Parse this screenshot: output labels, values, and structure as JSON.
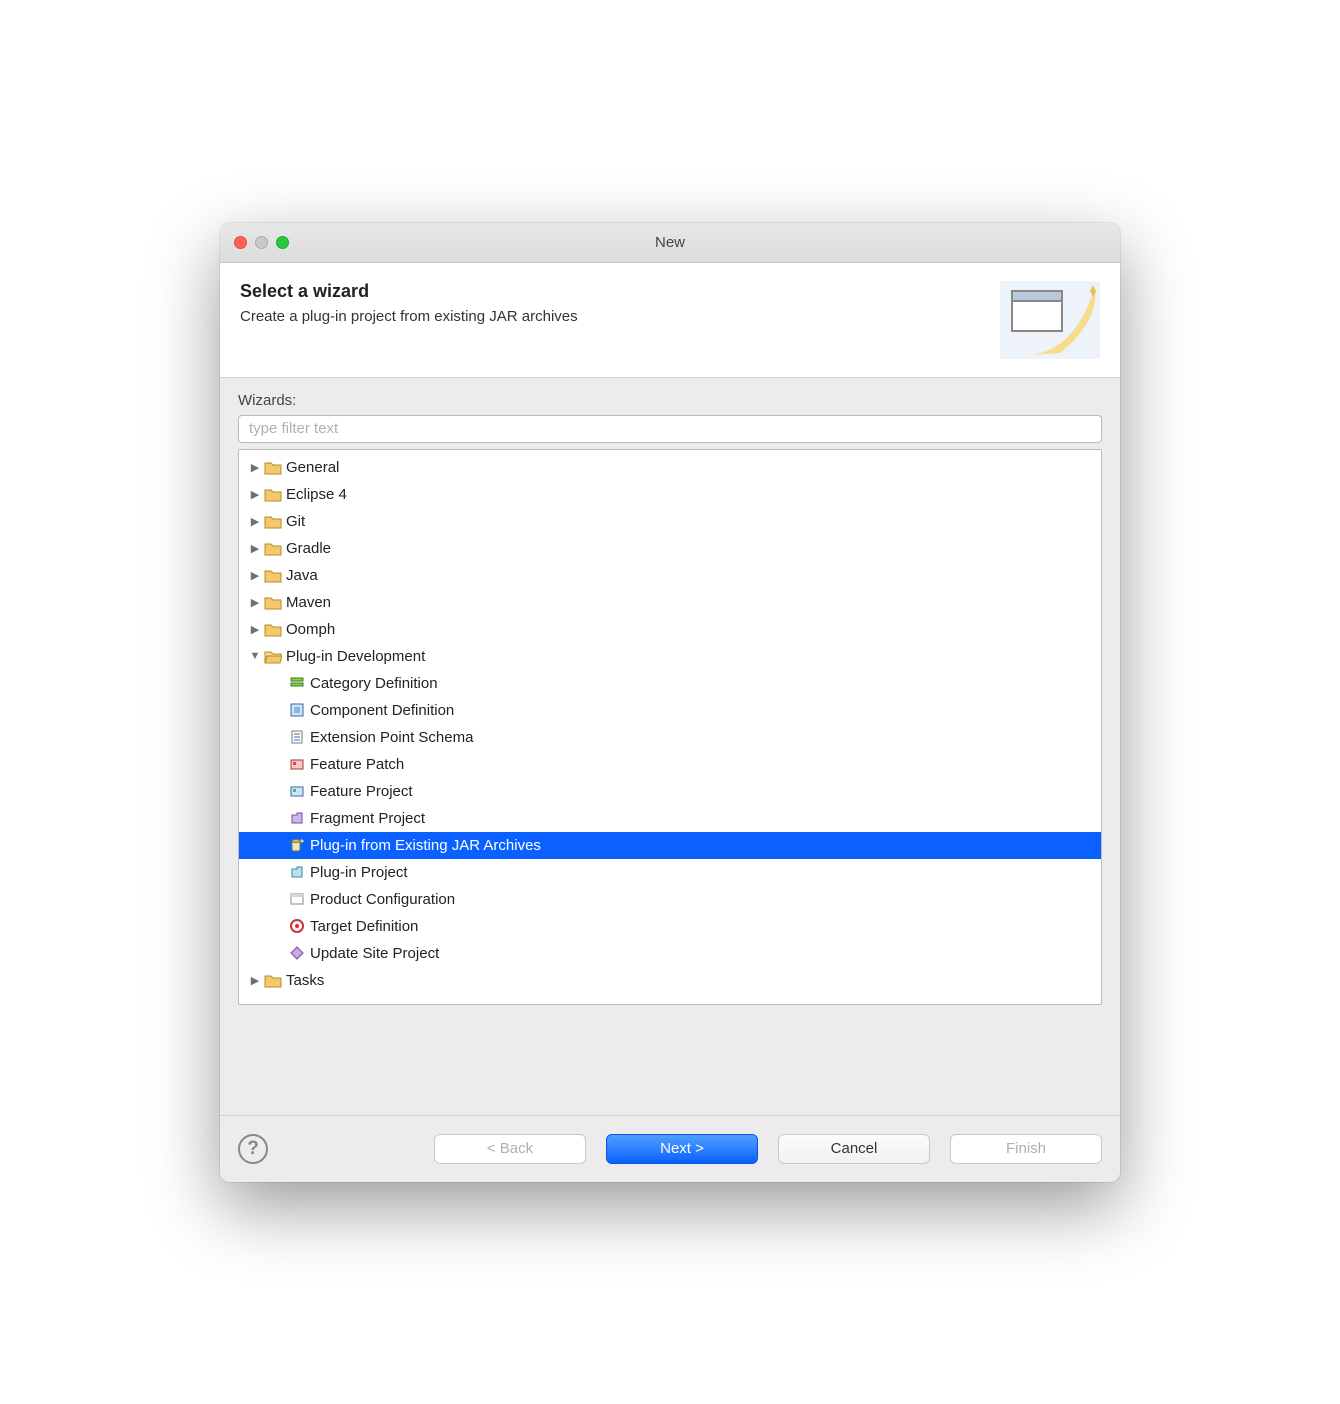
{
  "window": {
    "title": "New"
  },
  "header": {
    "title": "Select a wizard",
    "description": "Create a plug-in project from existing JAR archives"
  },
  "filter": {
    "label": "Wizards:",
    "placeholder": "type filter text"
  },
  "tree": {
    "roots": [
      {
        "label": "General",
        "expanded": false
      },
      {
        "label": "Eclipse 4",
        "expanded": false
      },
      {
        "label": "Git",
        "expanded": false
      },
      {
        "label": "Gradle",
        "expanded": false
      },
      {
        "label": "Java",
        "expanded": false
      },
      {
        "label": "Maven",
        "expanded": false
      },
      {
        "label": "Oomph",
        "expanded": false
      },
      {
        "label": "Plug-in Development",
        "expanded": true
      },
      {
        "label": "Tasks",
        "expanded": false
      }
    ],
    "plugin_dev_children": [
      {
        "label": "Category Definition",
        "icon": "category",
        "selected": false
      },
      {
        "label": "Component Definition",
        "icon": "component",
        "selected": false
      },
      {
        "label": "Extension Point Schema",
        "icon": "schema",
        "selected": false
      },
      {
        "label": "Feature Patch",
        "icon": "feature-patch",
        "selected": false
      },
      {
        "label": "Feature Project",
        "icon": "feature",
        "selected": false
      },
      {
        "label": "Fragment Project",
        "icon": "fragment",
        "selected": false
      },
      {
        "label": "Plug-in from Existing JAR Archives",
        "icon": "jar-plugin",
        "selected": true
      },
      {
        "label": "Plug-in Project",
        "icon": "plugin-project",
        "selected": false
      },
      {
        "label": "Product Configuration",
        "icon": "product",
        "selected": false
      },
      {
        "label": "Target Definition",
        "icon": "target",
        "selected": false
      },
      {
        "label": "Update Site Project",
        "icon": "update-site",
        "selected": false
      }
    ]
  },
  "buttons": {
    "back": "< Back",
    "next": "Next >",
    "cancel": "Cancel",
    "finish": "Finish"
  }
}
